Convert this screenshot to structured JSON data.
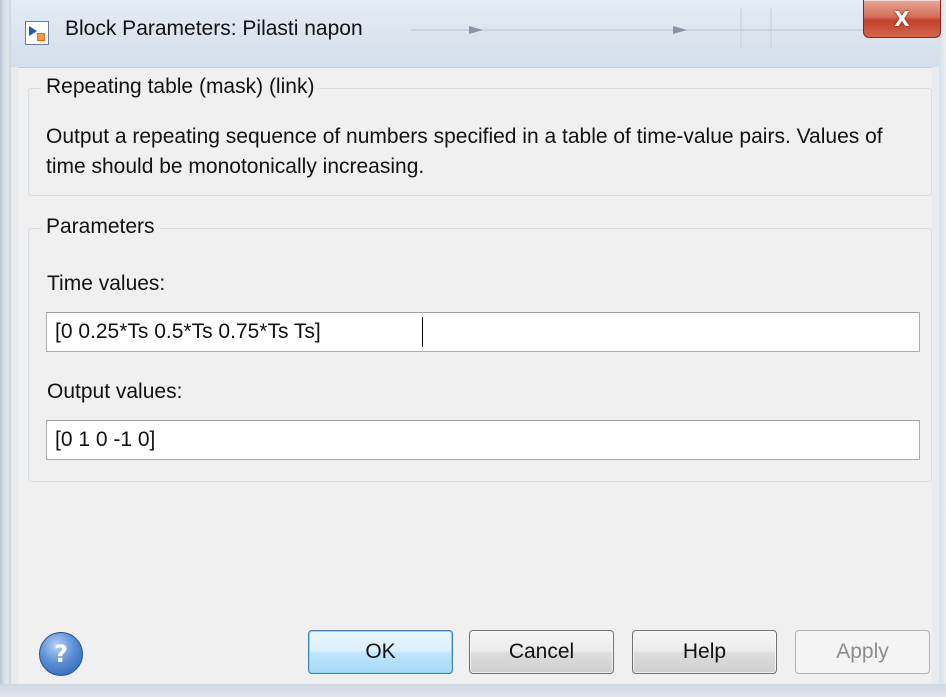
{
  "window": {
    "title": "Block Parameters: Pilasti napon",
    "close_glyph": "X"
  },
  "mask": {
    "group_title": "Repeating table (mask) (link)",
    "description": "Output a repeating sequence of numbers specified in a table of time-value pairs. Values of time should be monotonically increasing."
  },
  "parameters": {
    "group_title": "Parameters",
    "time_label": "Time values:",
    "time_value": "[0 0.25*Ts 0.5*Ts 0.75*Ts Ts]",
    "output_label": "Output values:",
    "output_value": "[0 1 0 -1 0]"
  },
  "buttons": {
    "help_glyph": "?",
    "ok": "OK",
    "cancel": "Cancel",
    "help": "Help",
    "apply": "Apply"
  },
  "icons": {
    "app": "simulink-block-icon",
    "close": "close-icon",
    "help": "help-question-icon"
  },
  "colors": {
    "close_button": "#c2412a",
    "default_button_border": "#3c7fb1",
    "dialog_bg": "#f0f0f0"
  }
}
